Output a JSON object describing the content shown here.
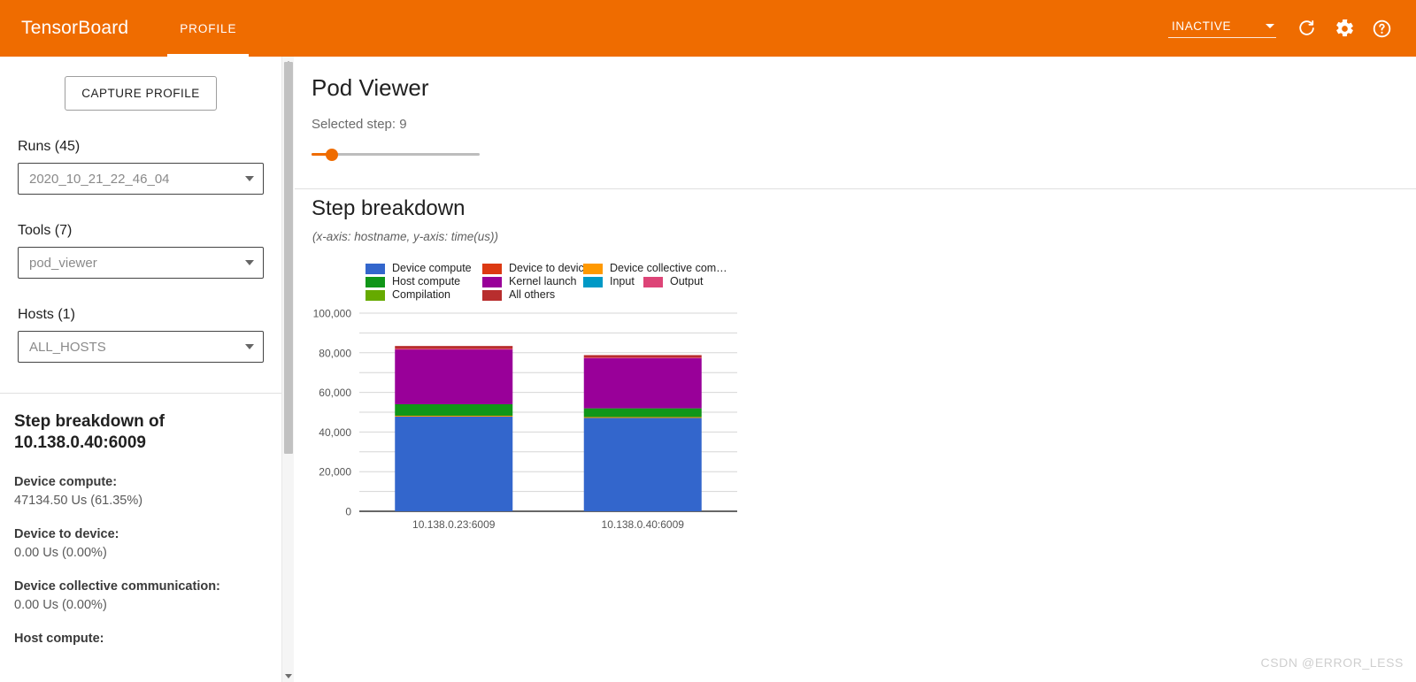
{
  "topbar": {
    "brand": "TensorBoard",
    "tabs": [
      {
        "label": "PROFILE",
        "active": true
      }
    ],
    "status": "INACTIVE",
    "icons": {
      "refresh": "refresh-icon",
      "settings": "gear-icon",
      "help": "help-icon"
    },
    "bg_color": "#ef6c00"
  },
  "sidebar": {
    "capture_button": "CAPTURE PROFILE",
    "fields": [
      {
        "label": "Runs (45)",
        "value": "2020_10_21_22_46_04",
        "name": "runs"
      },
      {
        "label": "Tools (7)",
        "value": "pod_viewer",
        "name": "tools"
      },
      {
        "label": "Hosts (1)",
        "value": "ALL_HOSTS",
        "name": "hosts"
      }
    ],
    "detail": {
      "title": "Step breakdown of 10.138.0.40:6009",
      "rows": [
        {
          "key": "Device compute:",
          "value": "47134.50 Us (61.35%)"
        },
        {
          "key": "Device to device:",
          "value": "0.00 Us (0.00%)"
        },
        {
          "key": "Device collective communication:",
          "value": "0.00 Us (0.00%)"
        },
        {
          "key": "Host compute:",
          "value": ""
        }
      ]
    }
  },
  "main": {
    "page_title": "Pod Viewer",
    "selected_step_label": "Selected step: 9",
    "slider": {
      "value": 9,
      "min": 0,
      "max": 100,
      "percent": 12,
      "accent": "#ef6c00"
    },
    "card_title": "Step breakdown",
    "card_subtitle": "(x-axis: hostname, y-axis: time(us))"
  },
  "watermark": "CSDN @ERROR_LESS",
  "chart_data": {
    "type": "bar",
    "stacked": true,
    "title": "Step breakdown",
    "subtitle": "(x-axis: hostname, y-axis: time(us))",
    "xlabel": "hostname",
    "ylabel": "time(us)",
    "ylim": [
      0,
      100000
    ],
    "yticks": [
      0,
      20000,
      40000,
      60000,
      80000,
      100000
    ],
    "ytick_labels": [
      "0",
      "20,000",
      "40,000",
      "60,000",
      "80,000",
      "100,000"
    ],
    "grid": true,
    "legend_position": "top",
    "categories": [
      "10.138.0.23:6009",
      "10.138.0.40:6009"
    ],
    "series": [
      {
        "name": "Device compute",
        "color": "#3366cc",
        "values": [
          47770,
          47135
        ]
      },
      {
        "name": "Device to device",
        "color": "#dc3912",
        "values": [
          0,
          0
        ]
      },
      {
        "name": "Device collective com…",
        "color": "#ff9900",
        "values": [
          450,
          420
        ]
      },
      {
        "name": "Host compute",
        "color": "#109618",
        "values": [
          5800,
          4400
        ]
      },
      {
        "name": "Kernel launch",
        "color": "#990099",
        "values": [
          27700,
          25400
        ]
      },
      {
        "name": "Input",
        "color": "#0099c6",
        "values": [
          0,
          0
        ]
      },
      {
        "name": "Output",
        "color": "#dd4477",
        "values": [
          300,
          260
        ]
      },
      {
        "name": "Compilation",
        "color": "#66aa00",
        "values": [
          0,
          0
        ]
      },
      {
        "name": "All others",
        "color": "#b82e2e",
        "values": [
          1400,
          1200
        ]
      }
    ],
    "totals": [
      83420,
      78815
    ]
  }
}
